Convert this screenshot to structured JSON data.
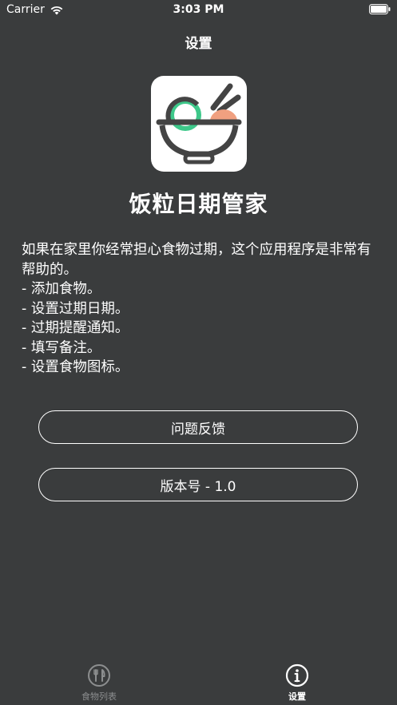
{
  "status_bar": {
    "carrier": "Carrier",
    "time": "3:03 PM"
  },
  "nav": {
    "title": "设置"
  },
  "app": {
    "name": "饭粒日期管家",
    "icon": "rice-bowl-icon"
  },
  "description": {
    "lines": [
      "如果在家里你经常担心食物过期，这个应用程序是非常有帮助的。",
      "- 添加食物。",
      "- 设置过期日期。",
      "- 过期提醒通知。",
      "- 填写备注。",
      "- 设置食物图标。"
    ]
  },
  "buttons": {
    "feedback": "问题反馈",
    "version": "版本号 - 1.0"
  },
  "tab_bar": {
    "food_list": "食物列表",
    "settings": "设置"
  },
  "colors": {
    "background": "#3a3c3d",
    "accent_green": "#3ec88a",
    "accent_orange": "#f0a080",
    "tab_inactive": "#8c8e8f"
  }
}
